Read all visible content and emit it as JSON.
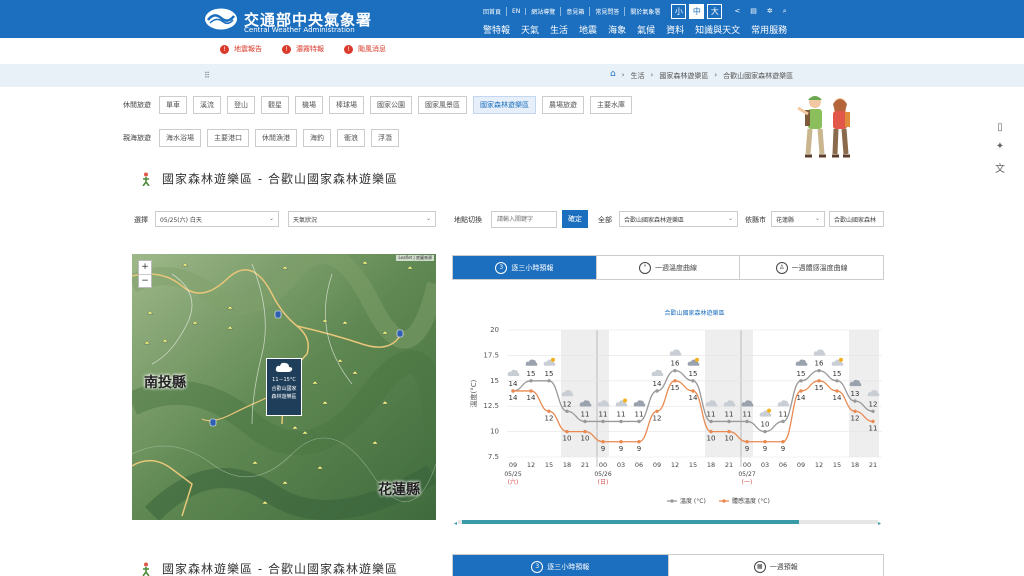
{
  "header": {
    "logo_zh": "交通部中央氣象署",
    "logo_en": "Central Weather Administration",
    "toplinks": [
      "回首頁",
      "EN",
      "網站導覽",
      "意見箱",
      "常見問答",
      "關於氣象署"
    ],
    "font_sizes": [
      "小",
      "中",
      "大"
    ],
    "active_font": "中",
    "nav": [
      "警特報",
      "天氣",
      "生活",
      "地震",
      "海象",
      "氣候",
      "資料",
      "知識與天文",
      "常用服務"
    ]
  },
  "alerts": [
    "地震報告",
    "濃霧特報",
    "颱風消息"
  ],
  "breadcrumb": [
    "生活",
    "國家森林遊樂區",
    "合歡山國家森林遊樂區"
  ],
  "leisure": {
    "label": "休閒旅遊",
    "items": [
      "單車",
      "溪流",
      "登山",
      "觀星",
      "機場",
      "棒球場",
      "國家公園",
      "國家風景區",
      "國家森林遊樂區",
      "農場旅遊",
      "主要水庫"
    ],
    "active": "國家森林遊樂區"
  },
  "marine": {
    "label": "親海旅遊",
    "items": [
      "海水浴場",
      "主要港口",
      "休閒漁港",
      "海釣",
      "衝浪",
      "浮潛"
    ]
  },
  "page_title": "國家森林遊樂區 - 合歡山國家森林遊樂區",
  "controls": {
    "select_label": "選擇",
    "date_value": "05/25(六) 白天",
    "weather_value": "天氣狀況",
    "location_label": "地點切換",
    "location_placeholder": "請輸入關鍵字",
    "confirm": "確定",
    "all_label": "全部",
    "area_value": "合歡山國家森林遊樂區",
    "county_label": "依縣市",
    "county_value": "花蓮縣",
    "area2_value": "合歡山國家森林"
  },
  "map": {
    "labels": [
      "南投縣",
      "花蓮縣"
    ],
    "popup_temp": "11－15°C",
    "popup_name": "合歡山國家森林遊樂區",
    "zoom_in": "+",
    "zoom_out": "−",
    "attribution": "Leaflet | 底圖來源"
  },
  "tabs": [
    "逐三小時預報",
    "一週溫度曲線",
    "一週體感溫度曲線"
  ],
  "chart_data": {
    "type": "line",
    "title": "合歡山國家森林遊樂區",
    "ylabel": "溫度(°C)",
    "ylim": [
      7.5,
      20
    ],
    "yticks": [
      7.5,
      10,
      12.5,
      15,
      17.5,
      20
    ],
    "x": [
      "09",
      "12",
      "15",
      "18",
      "21",
      "00",
      "03",
      "06",
      "09",
      "12",
      "15",
      "18",
      "21",
      "00",
      "03",
      "06",
      "09",
      "12",
      "15",
      "18",
      "21"
    ],
    "date_labels": [
      {
        "index": 0,
        "date": "05/25",
        "day": "(六)"
      },
      {
        "index": 5,
        "date": "05/26",
        "day": "(日)"
      },
      {
        "index": 13,
        "date": "05/27",
        "day": "(一)"
      }
    ],
    "series": [
      {
        "name": "溫度 (°C)",
        "color": "#999999",
        "values": [
          14,
          15,
          15,
          12,
          11,
          11,
          11,
          11,
          14,
          16,
          15,
          11,
          11,
          11,
          10,
          11,
          15,
          16,
          15,
          13,
          12
        ]
      },
      {
        "name": "體感溫度 (°C)",
        "color": "#e98a52",
        "values": [
          14,
          14,
          12,
          10,
          10,
          9,
          9,
          9,
          12,
          15,
          14,
          10,
          10,
          9,
          9,
          9,
          14,
          15,
          14,
          12,
          11
        ]
      }
    ],
    "legend_position": "bottom"
  },
  "bottom": {
    "title": "國家森林遊樂區 - 合歡山國家森林遊樂區",
    "tabs": [
      "逐三小時預報",
      "一週預報"
    ]
  }
}
